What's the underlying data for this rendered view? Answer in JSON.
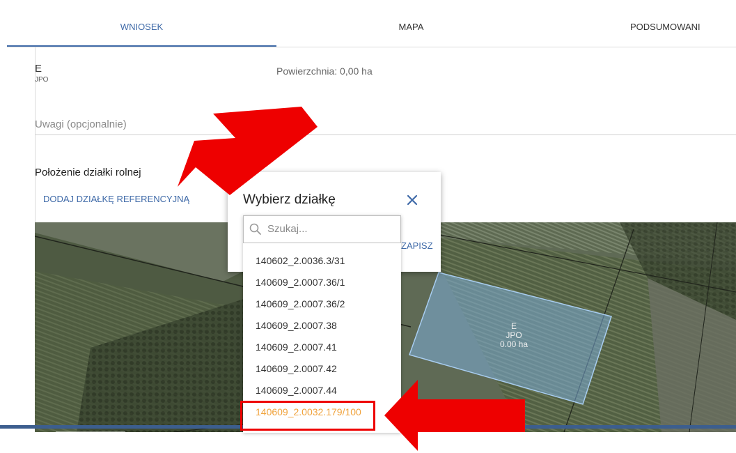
{
  "tabs": [
    {
      "label": "WNIOSEK",
      "active": true
    },
    {
      "label": "MAPA",
      "active": false
    },
    {
      "label": "PODSUMOWANI",
      "active": false
    }
  ],
  "plot": {
    "code": "E",
    "type": "JPO",
    "area": "Powierzchnia: 0,00 ha"
  },
  "notes": {
    "placeholder": "Uwagi (opcjonalnie)"
  },
  "location": {
    "heading": "Położenie działki rolnej",
    "add_reference": "DODAJ DZIAŁKĘ REFERENCYJNĄ"
  },
  "map": {
    "parcel": {
      "code": "E",
      "type": "JPO",
      "area": "0.00 ha"
    }
  },
  "dialog": {
    "title": "Wybierz działkę",
    "save_label": "ZAPISZ"
  },
  "dropdown": {
    "placeholder": "Szukaj...",
    "options": [
      "140602_2.0036.3/31",
      "140609_2.0007.36/1",
      "140609_2.0007.36/2",
      "140609_2.0007.38",
      "140609_2.0007.41",
      "140609_2.0007.42",
      "140609_2.0007.44",
      "140609_2.0032.179/100"
    ],
    "highlighted_option": "140609_2.0032.179/100"
  },
  "colors": {
    "accent": "#3f6aa8",
    "highlight": "#f0a23b",
    "annotation": "#ee0000"
  }
}
